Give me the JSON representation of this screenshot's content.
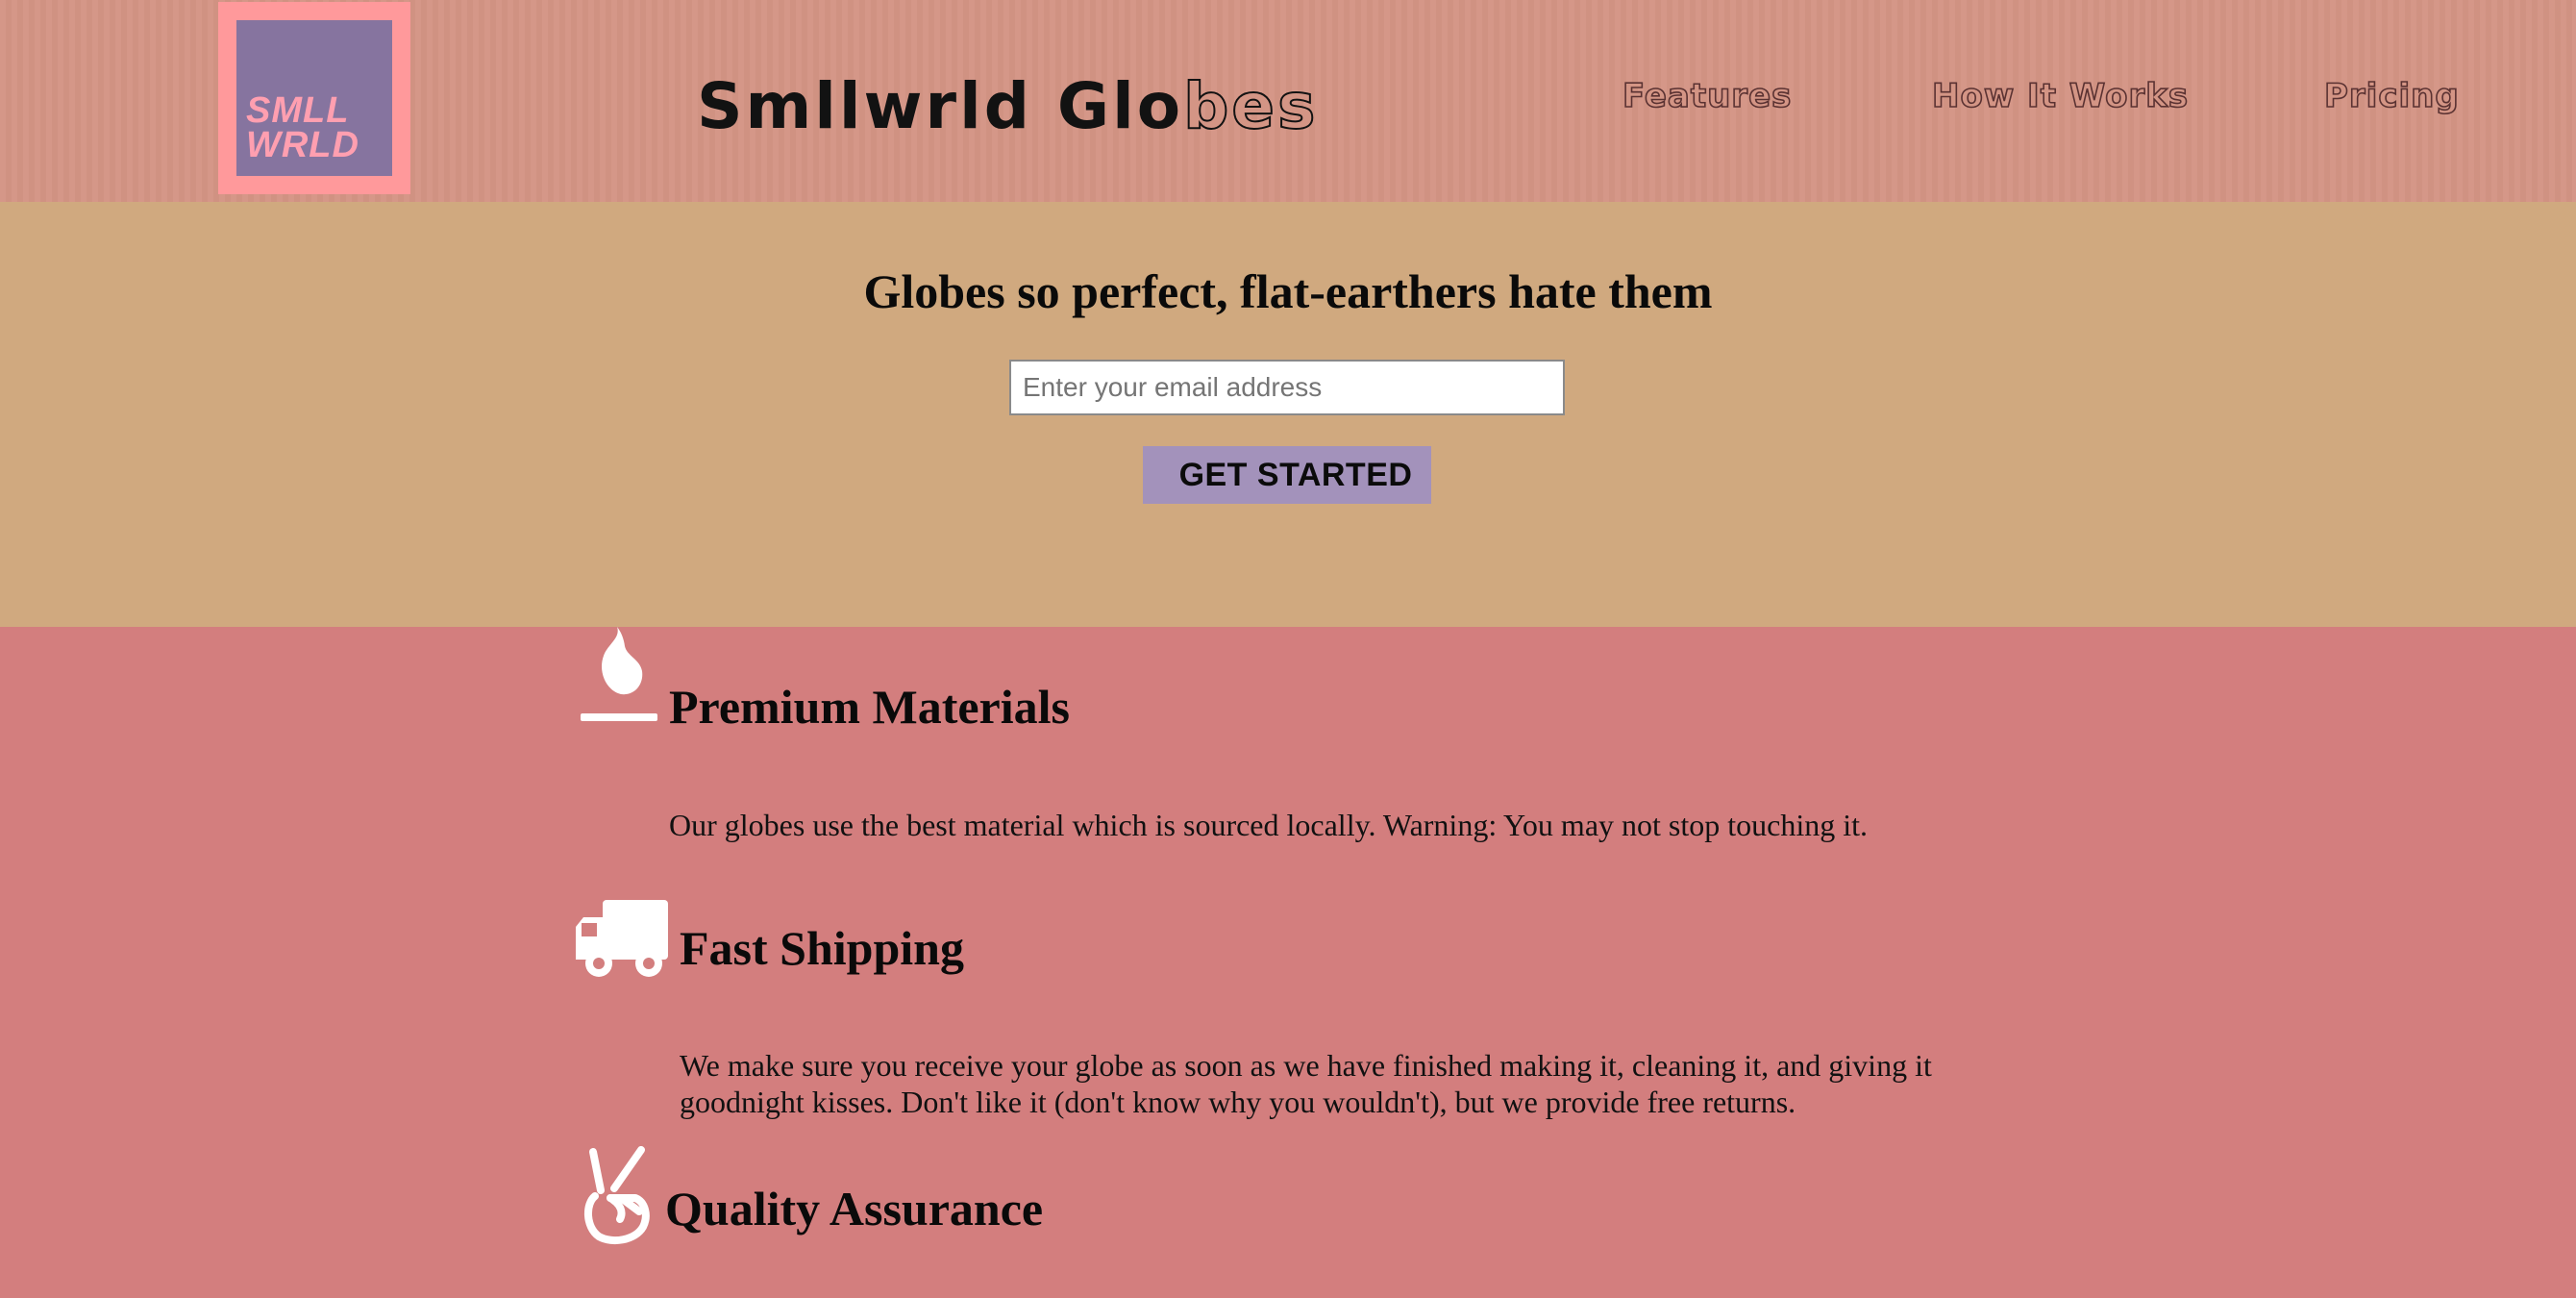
{
  "header": {
    "logo_line1": "SMLL",
    "logo_line2": "WRLD",
    "title_main": "Smllwrld Glo",
    "title_outlined": "bes",
    "nav": {
      "features": "Features",
      "how_it_works": "How It Works",
      "pricing": "Pricing"
    }
  },
  "hero": {
    "title": "Globes so perfect, flat-earthers hate them",
    "email_placeholder": "Enter your email address",
    "cta_label": "GET STARTED"
  },
  "features": [
    {
      "icon": "fire-icon",
      "title": "Premium Materials",
      "description": "Our globes use the best material which is sourced locally. Warning: You may not stop touching it."
    },
    {
      "icon": "truck-icon",
      "title": "Fast Shipping",
      "description": "We make sure you receive your globe as soon as we have finished making it, cleaning it, and giving it goodnight kisses. Don't like it (don't know why you wouldn't), but we provide free returns."
    },
    {
      "icon": "peace-hand-icon",
      "title": "Quality Assurance"
    }
  ],
  "colors": {
    "header_bg": "#d49585",
    "hero_bg": "#d0a97f",
    "features_bg": "#d37e7e",
    "logo_frame": "#ff999b",
    "logo_fill": "#86749f",
    "cta_bg": "#a392bb"
  }
}
